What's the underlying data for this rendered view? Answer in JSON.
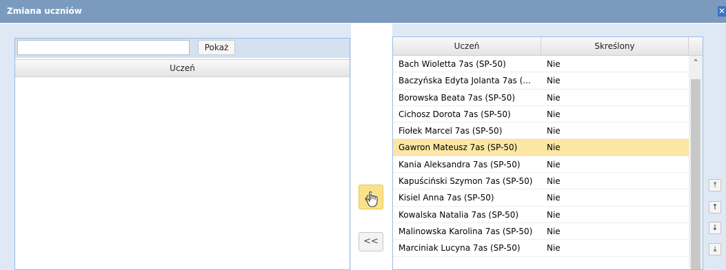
{
  "window": {
    "title": "Zmiana uczniów",
    "close_glyph": "✕"
  },
  "left": {
    "search_value": "",
    "show_label": "Pokaż",
    "column_header": "Uczeń"
  },
  "middle": {
    "move_all_left_label": "<<",
    "move_left_icon": "hand-pointer-icon"
  },
  "right": {
    "columns": [
      "Uczeń",
      "Skreślony"
    ],
    "rows": [
      {
        "name": "Bach Wioletta 7as (SP-50)",
        "deleted": "Nie"
      },
      {
        "name": "Baczyńska Edyta Jolanta 7as (...",
        "deleted": "Nie"
      },
      {
        "name": "Borowska Beata 7as (SP-50)",
        "deleted": "Nie"
      },
      {
        "name": "Cichosz Dorota 7as (SP-50)",
        "deleted": "Nie"
      },
      {
        "name": "Fiołek Marcel 7as (SP-50)",
        "deleted": "Nie"
      },
      {
        "name": "Gawron Mateusz 7as (SP-50)",
        "deleted": "Nie",
        "selected": true
      },
      {
        "name": "Kania Aleksandra 7as (SP-50)",
        "deleted": "Nie"
      },
      {
        "name": "Kapuściński Szymon 7as (SP-50)",
        "deleted": "Nie"
      },
      {
        "name": "Kisiel Anna 7as (SP-50)",
        "deleted": "Nie"
      },
      {
        "name": "Kowalska Natalia 7as (SP-50)",
        "deleted": "Nie"
      },
      {
        "name": "Malinowska Karolina 7as (SP-50)",
        "deleted": "Nie"
      },
      {
        "name": "Marciniak Lucyna 7as (SP-50)",
        "deleted": "Nie"
      }
    ]
  },
  "order_buttons": [
    {
      "name": "move-top-button",
      "glyph": "⤒"
    },
    {
      "name": "move-up-button",
      "glyph": "↑"
    },
    {
      "name": "move-down-button",
      "glyph": "↓"
    },
    {
      "name": "move-bottom-button",
      "glyph": "⤓"
    }
  ],
  "colors": {
    "titlebar": "#7a9bbd",
    "selected_row": "#fce6a4",
    "active_button": "#fbe28a"
  }
}
